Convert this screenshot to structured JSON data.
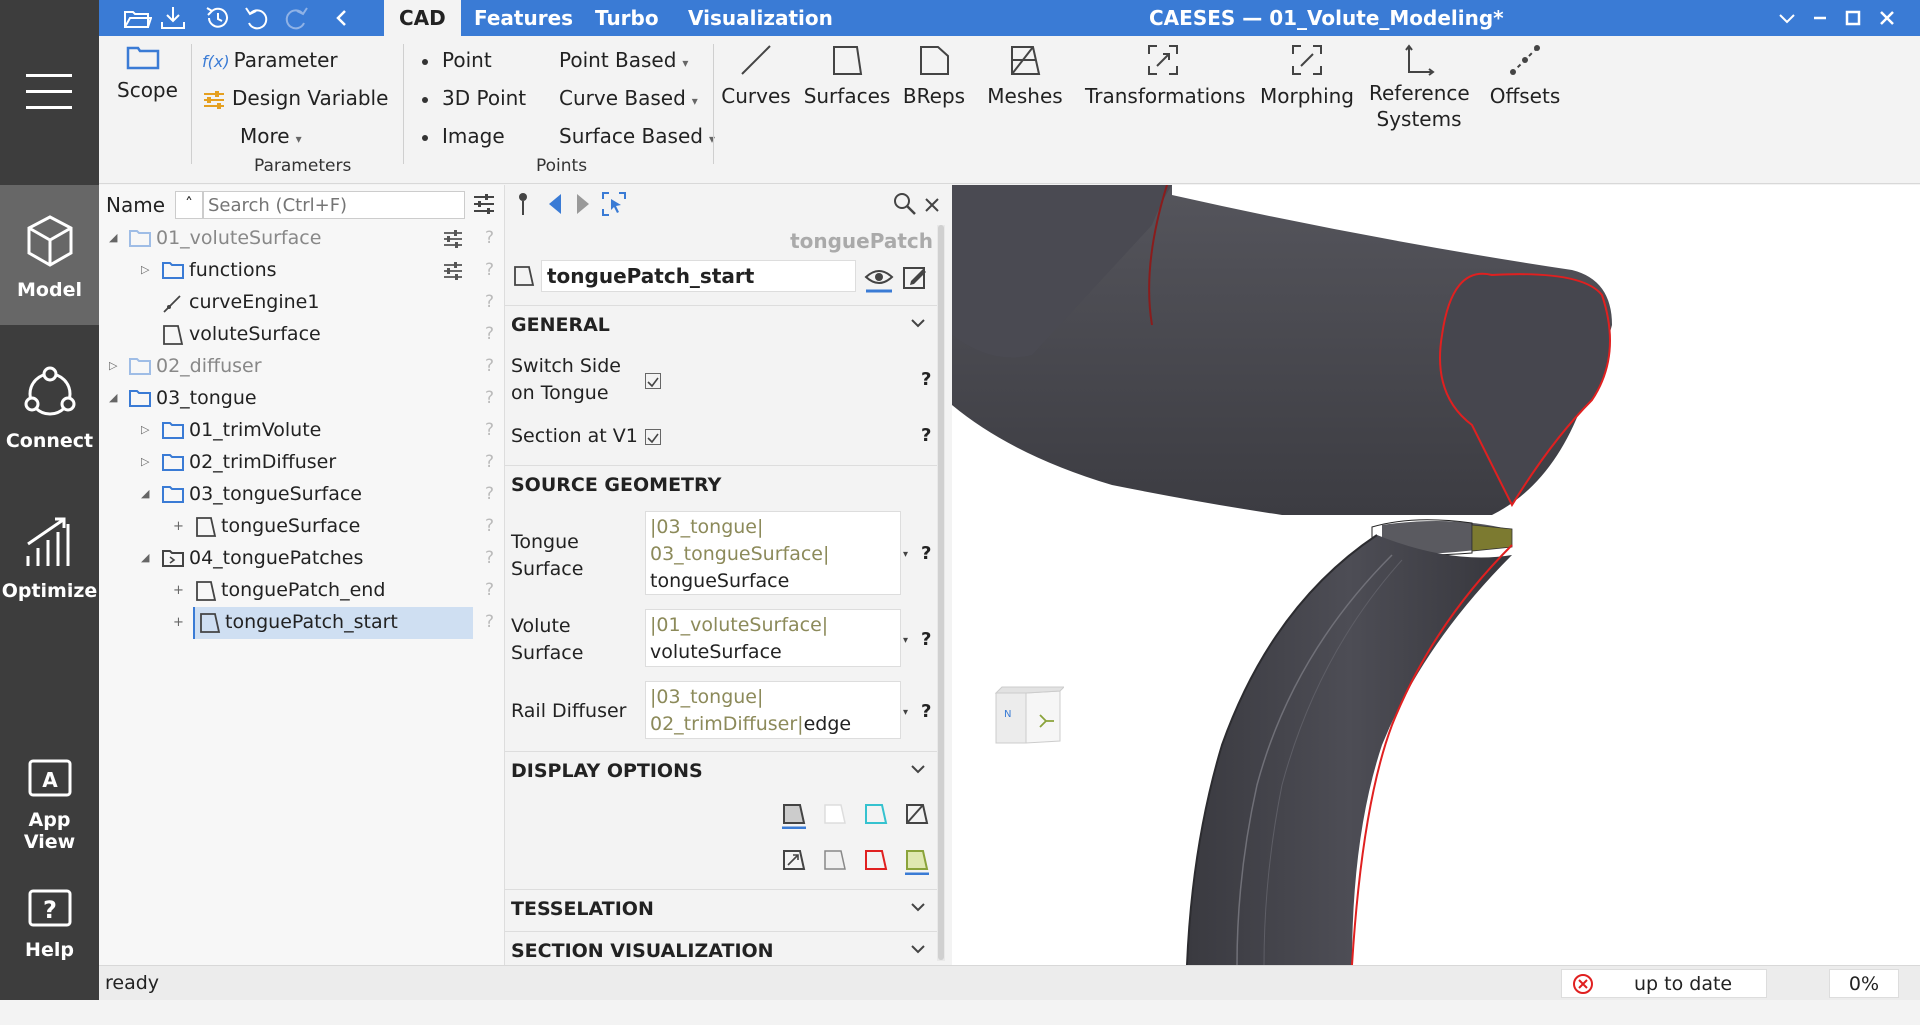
{
  "sidenav": {
    "items": [
      {
        "label": "Model"
      },
      {
        "label": "Connect"
      },
      {
        "label": "Optimize"
      },
      {
        "label": "App View"
      },
      {
        "label": "Help"
      }
    ]
  },
  "menubar": {
    "tabs": [
      "CAD",
      "Features",
      "Turbo",
      "Visualization"
    ],
    "active_tab": "CAD",
    "title": "CAESES — 01_Volute_Modeling*"
  },
  "ribbon": {
    "scope": "Scope",
    "parameter": "Parameter",
    "parameter_prefix": "f(x)",
    "design_variable": "Design Variable",
    "more": "More",
    "group_parameters": "Parameters",
    "point": "Point",
    "point_3d": "3D Point",
    "image": "Image",
    "point_based": "Point Based",
    "curve_based": "Curve Based",
    "surface_based": "Surface Based",
    "group_points": "Points",
    "curves": "Curves",
    "surfaces": "Surfaces",
    "breps": "BReps",
    "meshes": "Meshes",
    "transformations": "Transformations",
    "morphing": "Morphing",
    "reference_systems": "Reference Systems",
    "offsets": "Offsets"
  },
  "tree": {
    "header_name": "Name",
    "search_placeholder": "Search (Ctrl+F)",
    "rows": [
      {
        "label": "01_voluteSurface"
      },
      {
        "label": "functions"
      },
      {
        "label": "curveEngine1"
      },
      {
        "label": "voluteSurface"
      },
      {
        "label": "02_diffuser"
      },
      {
        "label": "03_tongue"
      },
      {
        "label": "01_trimVolute"
      },
      {
        "label": "02_trimDiffuser"
      },
      {
        "label": "03_tongueSurface"
      },
      {
        "label": "tongueSurface"
      },
      {
        "label": "04_tonguePatches"
      },
      {
        "label": "tonguePatch_end"
      },
      {
        "label": "tonguePatch_start"
      }
    ],
    "help_mark": "?"
  },
  "props": {
    "object_type": "tonguePatch",
    "name": "tonguePatch_start",
    "sections": {
      "general": "GENERAL",
      "source_geometry": "SOURCE GEOMETRY",
      "display_options": "DISPLAY OPTIONS",
      "tesselation": "TESSELATION",
      "section_visualization": "SECTION VISUALIZATION"
    },
    "switch_side": "Switch Side on Tongue",
    "section_at_v1": "Section at V1",
    "tongue_surface_label": "Tongue Surface",
    "tongue_surface_path1": "|03_tongue|",
    "tongue_surface_path2": "03_tongueSurface|",
    "tongue_surface_value": "tongueSurface",
    "volute_surface_label": "Volute Surface",
    "volute_surface_path": "|01_voluteSurface|",
    "volute_surface_value": "voluteSurface",
    "rail_diffuser_label": "Rail Diffuser",
    "rail_diffuser_path1": "|03_tongue|",
    "rail_diffuser_path2": "02_trimDiffuser|",
    "rail_diffuser_value": "edge",
    "help_mark": "?"
  },
  "viewcube": {
    "north": "N",
    "axis": "Y"
  },
  "status": {
    "text": "ready",
    "update_state": "up to date",
    "progress": "0%"
  },
  "colors": {
    "accent": "#3a7bd5",
    "sidenav": "#3d3d3d",
    "surface": "#4a4a52",
    "edge": "#e02020",
    "path_text": "#8c8a5a"
  }
}
